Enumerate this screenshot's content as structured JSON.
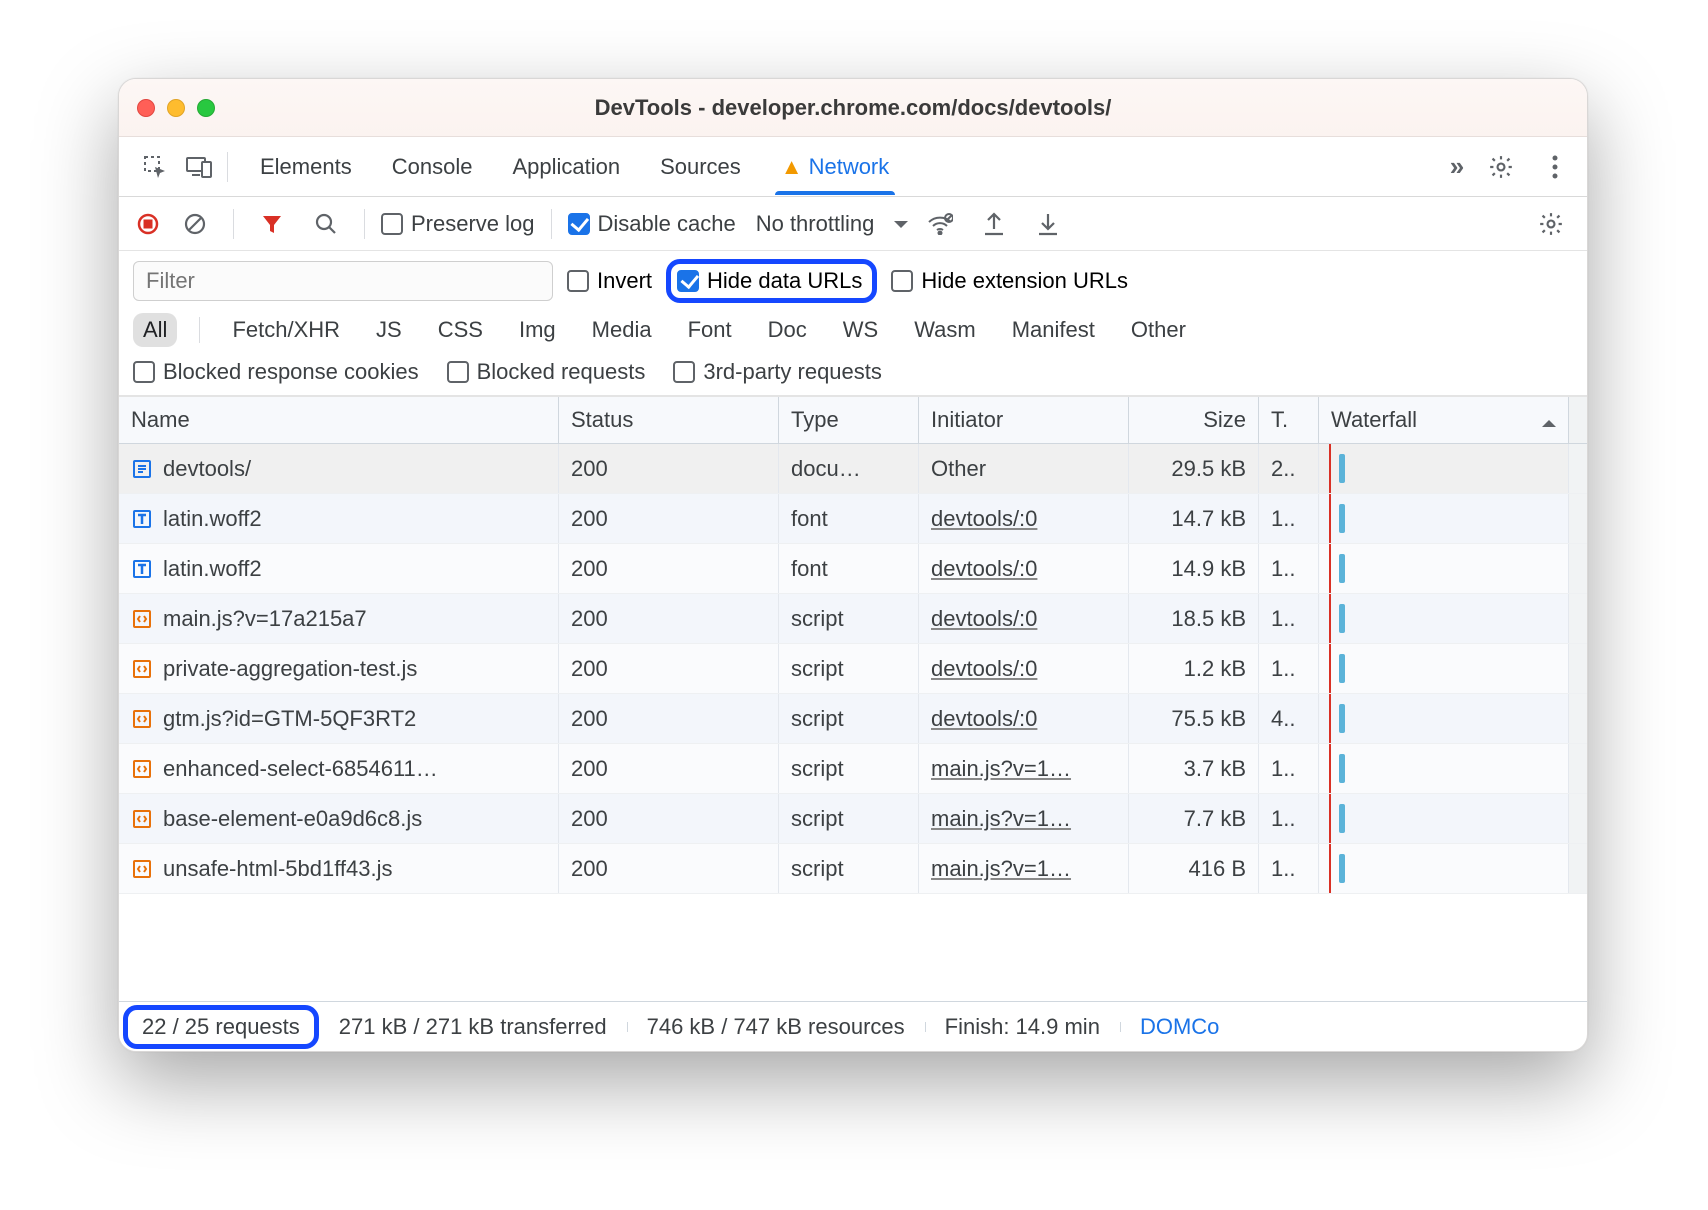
{
  "window": {
    "title": "DevTools - developer.chrome.com/docs/devtools/"
  },
  "tabs": {
    "items": [
      "Elements",
      "Console",
      "Application",
      "Sources",
      "Network"
    ],
    "active": 4
  },
  "toolbar": {
    "preserve_log": "Preserve log",
    "preserve_log_checked": false,
    "disable_cache": "Disable cache",
    "disable_cache_checked": true,
    "throttling": "No throttling"
  },
  "filter": {
    "placeholder": "Filter",
    "invert": {
      "label": "Invert",
      "checked": false
    },
    "hide_data_urls": {
      "label": "Hide data URLs",
      "checked": true
    },
    "hide_ext_urls": {
      "label": "Hide extension URLs",
      "checked": false
    },
    "types": [
      "All",
      "Fetch/XHR",
      "JS",
      "CSS",
      "Img",
      "Media",
      "Font",
      "Doc",
      "WS",
      "Wasm",
      "Manifest",
      "Other"
    ],
    "active_type": 0,
    "blocked_cookies": {
      "label": "Blocked response cookies",
      "checked": false
    },
    "blocked_requests": {
      "label": "Blocked requests",
      "checked": false
    },
    "third_party": {
      "label": "3rd-party requests",
      "checked": false
    }
  },
  "columns": {
    "name": "Name",
    "status": "Status",
    "type": "Type",
    "initiator": "Initiator",
    "size": "Size",
    "time": "T.",
    "waterfall": "Waterfall"
  },
  "rows": [
    {
      "icon": "doc",
      "name": "devtools/",
      "status": "200",
      "type": "docu…",
      "initiator": "Other",
      "initiator_link": false,
      "size": "29.5 kB",
      "time": "2..",
      "sel": true
    },
    {
      "icon": "font",
      "name": "latin.woff2",
      "status": "200",
      "type": "font",
      "initiator": "devtools/:0",
      "initiator_link": true,
      "size": "14.7 kB",
      "time": "1.."
    },
    {
      "icon": "font",
      "name": "latin.woff2",
      "status": "200",
      "type": "font",
      "initiator": "devtools/:0",
      "initiator_link": true,
      "size": "14.9 kB",
      "time": "1.."
    },
    {
      "icon": "script",
      "name": "main.js?v=17a215a7",
      "status": "200",
      "type": "script",
      "initiator": "devtools/:0",
      "initiator_link": true,
      "size": "18.5 kB",
      "time": "1.."
    },
    {
      "icon": "script",
      "name": "private-aggregation-test.js",
      "status": "200",
      "type": "script",
      "initiator": "devtools/:0",
      "initiator_link": true,
      "size": "1.2 kB",
      "time": "1.."
    },
    {
      "icon": "script",
      "name": "gtm.js?id=GTM-5QF3RT2",
      "status": "200",
      "type": "script",
      "initiator": "devtools/:0",
      "initiator_link": true,
      "size": "75.5 kB",
      "time": "4.."
    },
    {
      "icon": "script",
      "name": "enhanced-select-6854611…",
      "status": "200",
      "type": "script",
      "initiator": "main.js?v=1…",
      "initiator_link": true,
      "size": "3.7 kB",
      "time": "1.."
    },
    {
      "icon": "script",
      "name": "base-element-e0a9d6c8.js",
      "status": "200",
      "type": "script",
      "initiator": "main.js?v=1…",
      "initiator_link": true,
      "size": "7.7 kB",
      "time": "1.."
    },
    {
      "icon": "script",
      "name": "unsafe-html-5bd1ff43.js",
      "status": "200",
      "type": "script",
      "initiator": "main.js?v=1…",
      "initiator_link": true,
      "size": "416 B",
      "time": "1.."
    }
  ],
  "status_bar": {
    "requests": "22 / 25 requests",
    "transferred": "271 kB / 271 kB transferred",
    "resources": "746 kB / 747 kB resources",
    "finish": "Finish: 14.9 min",
    "domcontent": "DOMCo"
  }
}
